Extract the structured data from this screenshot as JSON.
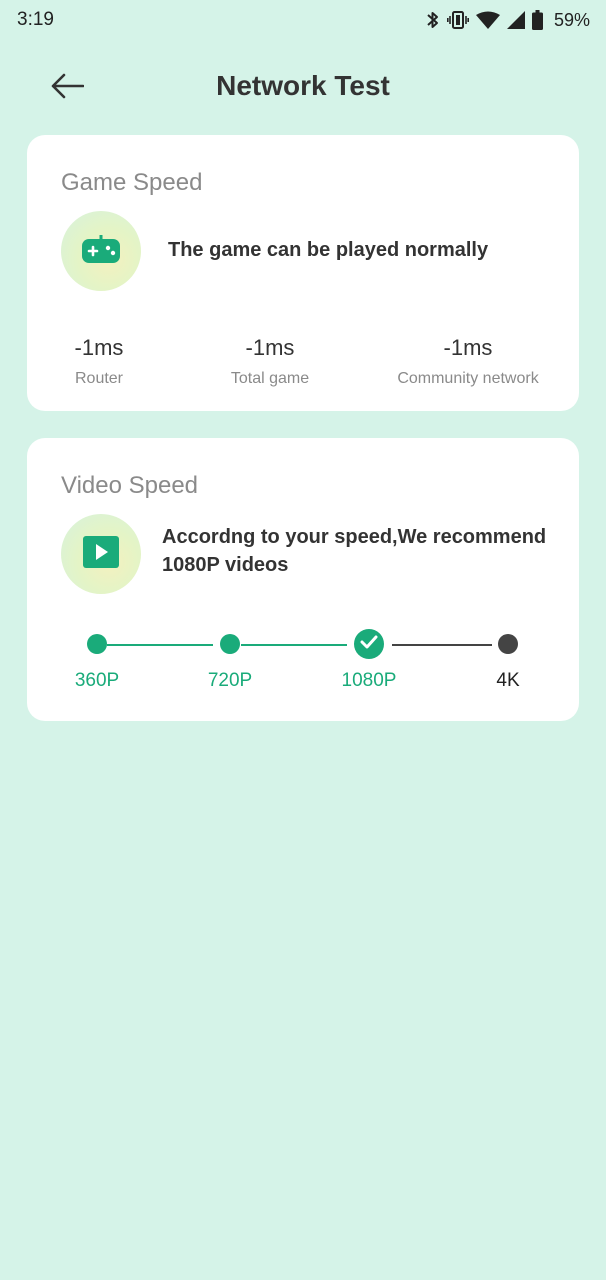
{
  "status_bar": {
    "time": "3:19",
    "battery": "59%",
    "icons": [
      "bluetooth-icon",
      "vibrate-icon",
      "wifi-icon",
      "cell-signal-icon",
      "battery-icon"
    ]
  },
  "header": {
    "title": "Network Test",
    "back_icon": "arrow-left-icon"
  },
  "game_speed": {
    "title": "Game Speed",
    "icon": "gamepad-icon",
    "status": "The game can be played normally",
    "metrics": [
      {
        "value": "-1ms",
        "label": "Router"
      },
      {
        "value": "-1ms",
        "label": "Total game"
      },
      {
        "value": "-1ms",
        "label": "Community network"
      }
    ]
  },
  "video_speed": {
    "title": "Video Speed",
    "icon": "play-icon",
    "recommendation": "Accordng to your speed,We recommend 1080P videos",
    "resolutions": [
      {
        "label": "360P",
        "state": "reached"
      },
      {
        "label": "720P",
        "state": "reached"
      },
      {
        "label": "1080P",
        "state": "selected"
      },
      {
        "label": "4K",
        "state": "unreached"
      }
    ]
  },
  "colors": {
    "background": "#d5f3e8",
    "accent": "#1aab7a",
    "card": "#ffffff",
    "inactive": "#444444"
  }
}
